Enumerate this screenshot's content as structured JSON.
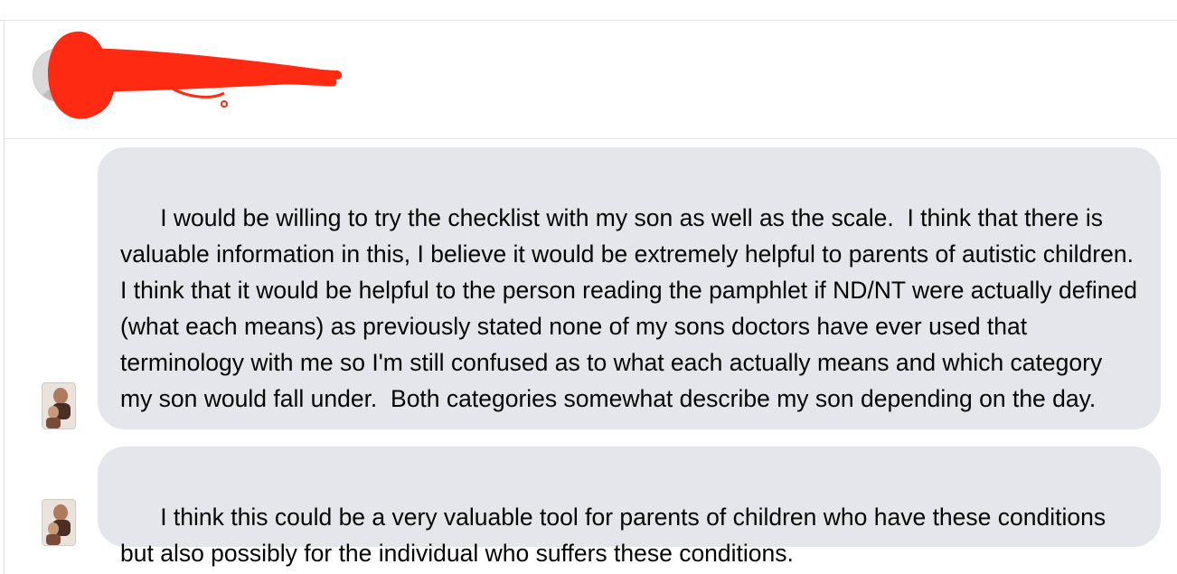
{
  "conversation": {
    "contact_name": "",
    "timestamp": "",
    "messages": [
      {
        "text": "I would be willing to try the checklist with my son as well as the scale.  I think that there is valuable information in this, I believe it would be extremely helpful to parents of autistic children.  I think that it would be helpful to the person reading the pamphlet if ND/NT were actually defined (what each means) as previously stated none of my sons doctors have ever used that terminology with me so I'm still confused as to what each actually means and which category my son would fall under.  Both categories somewhat describe my son depending on the day."
      },
      {
        "text": "I think this could be a very valuable tool for parents of children who have these conditions but also possibly for the individual who suffers these conditions."
      }
    ]
  },
  "colors": {
    "bubble_background": "#e4e6eb",
    "text": "#050505",
    "redaction": "#ff2a12"
  },
  "icons": {
    "contact_avatar": "profile-photo",
    "sender_avatar": "profile-photo"
  }
}
